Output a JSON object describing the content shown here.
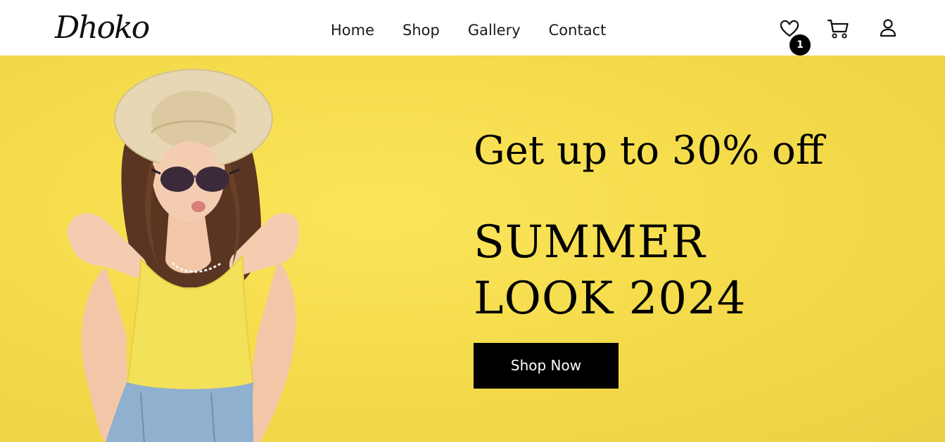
{
  "header": {
    "logo_text": "Dhoko",
    "nav": [
      "Home",
      "Shop",
      "Gallery",
      "Contact"
    ],
    "icons": {
      "wishlist": "heart-icon",
      "cart": "cart-icon",
      "account": "user-icon"
    },
    "wishlist_count": "1"
  },
  "hero": {
    "headline": "Get up to 30% off",
    "title_line1": "SUMMER",
    "title_line2": "LOOK 2024",
    "cta_label": "Shop Now",
    "background_color": "#f5dc4c",
    "image_icon": "fashion-model-photo"
  }
}
